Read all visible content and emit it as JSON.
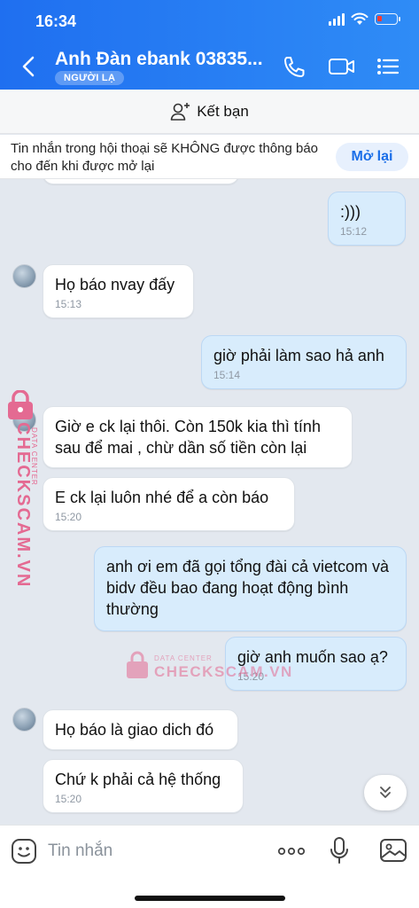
{
  "status": {
    "time": "16:34"
  },
  "header": {
    "contact_name": "Anh Đàn ebank 03835...",
    "badge": "NGƯỜI LẠ"
  },
  "add_friend": {
    "label": "Kết bạn"
  },
  "notice": {
    "text": "Tin nhắn trong hội thoại sẽ KHÔNG được thông báo cho đến khi được mở lại",
    "button": "Mở lại"
  },
  "messages": [
    {
      "dir": "out",
      "text": ":)))",
      "time": "15:12"
    },
    {
      "dir": "in",
      "text": "Họ báo nvay đấy",
      "time": "15:13"
    },
    {
      "dir": "out",
      "text": "giờ phải làm sao hả anh",
      "time": "15:14"
    },
    {
      "dir": "in",
      "text": "Giờ e ck lại thôi. Còn 150k kia thì tính sau để mai , chừ dần số tiền còn lại",
      "time": ""
    },
    {
      "dir": "in",
      "text": "E ck lại luôn nhé để a còn báo",
      "time": "15:20"
    },
    {
      "dir": "out",
      "text": "anh ơi em đã gọi tổng đài cả vietcom và bidv đều bao đang hoạt động bình thường",
      "time": ""
    },
    {
      "dir": "out",
      "text": "giờ anh muốn sao ạ?",
      "time": "15:20"
    },
    {
      "dir": "in",
      "text": "Họ báo là giao dich đó",
      "time": ""
    },
    {
      "dir": "in",
      "text": "Chứ k phải cả hệ thống",
      "time": "15:20"
    }
  ],
  "watermark": {
    "brand": "CHECKSCAM.VN",
    "sub": "DATA CENTER"
  },
  "input": {
    "placeholder": "Tin nhắn"
  },
  "colors": {
    "header": "#2f8cf6",
    "out_bubble": "#d8ecfc",
    "in_bubble": "#ffffff",
    "watermark": "#e46a92"
  }
}
